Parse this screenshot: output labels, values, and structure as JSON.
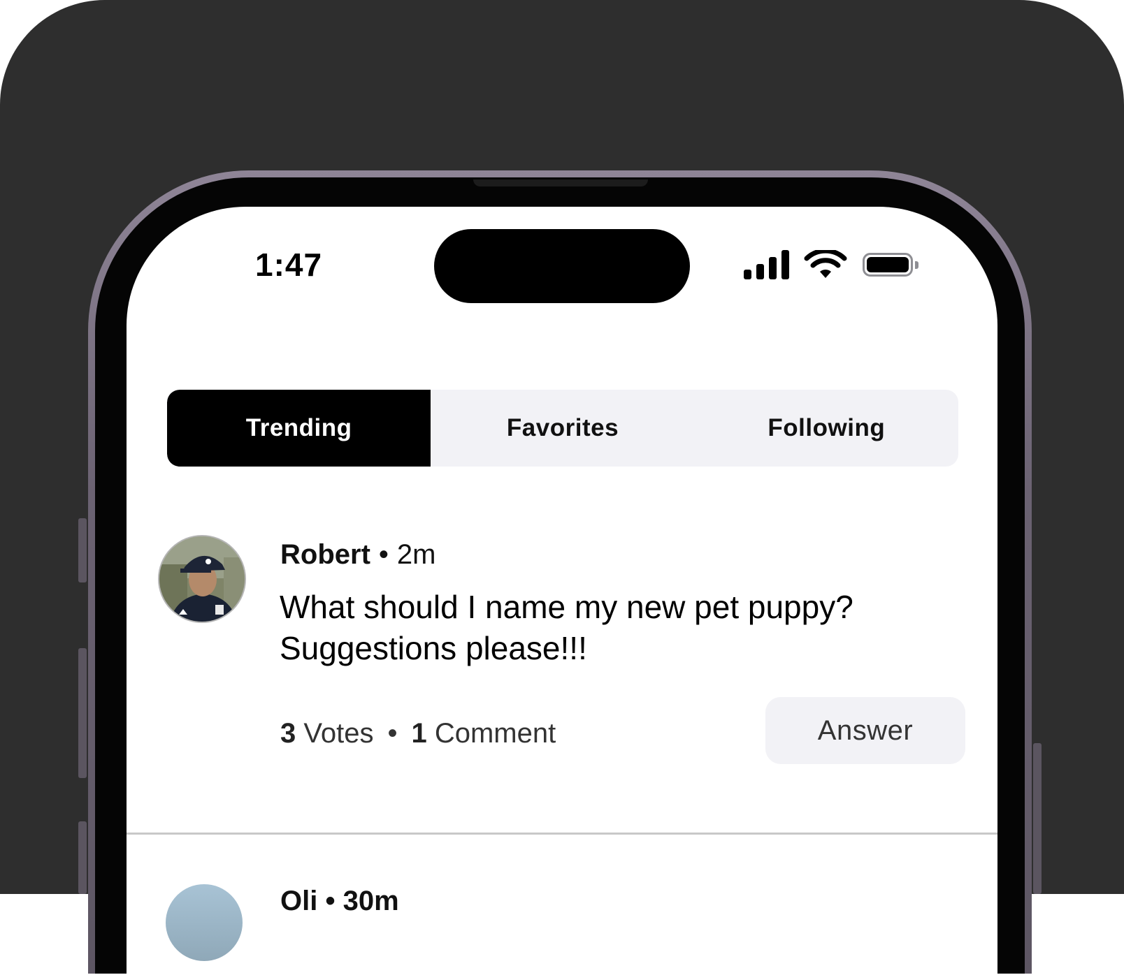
{
  "status_bar": {
    "time": "1:47",
    "icons": [
      "cellular-signal-icon",
      "wifi-icon",
      "battery-icon"
    ],
    "battery_level": 1.0
  },
  "tabs": [
    {
      "label": "Trending",
      "active": true
    },
    {
      "label": "Favorites",
      "active": false
    },
    {
      "label": "Following",
      "active": false
    }
  ],
  "posts": [
    {
      "author": "Robert",
      "separator": "•",
      "time": "2m",
      "text": "What should I name my new pet puppy? Suggestions please!!!",
      "votes_count": "3",
      "votes_label": "Votes",
      "stats_separator": "•",
      "comments_count": "1",
      "comments_label": "Comment",
      "answer_label": "Answer"
    },
    {
      "author": "Oli",
      "separator": "•",
      "time": "30m"
    }
  ],
  "colors": {
    "background": "#2e2e2e",
    "screen": "#ffffff",
    "active_tab": "#000000",
    "inactive_tab": "#f2f2f6",
    "answer_button": "#f2f2f6"
  }
}
